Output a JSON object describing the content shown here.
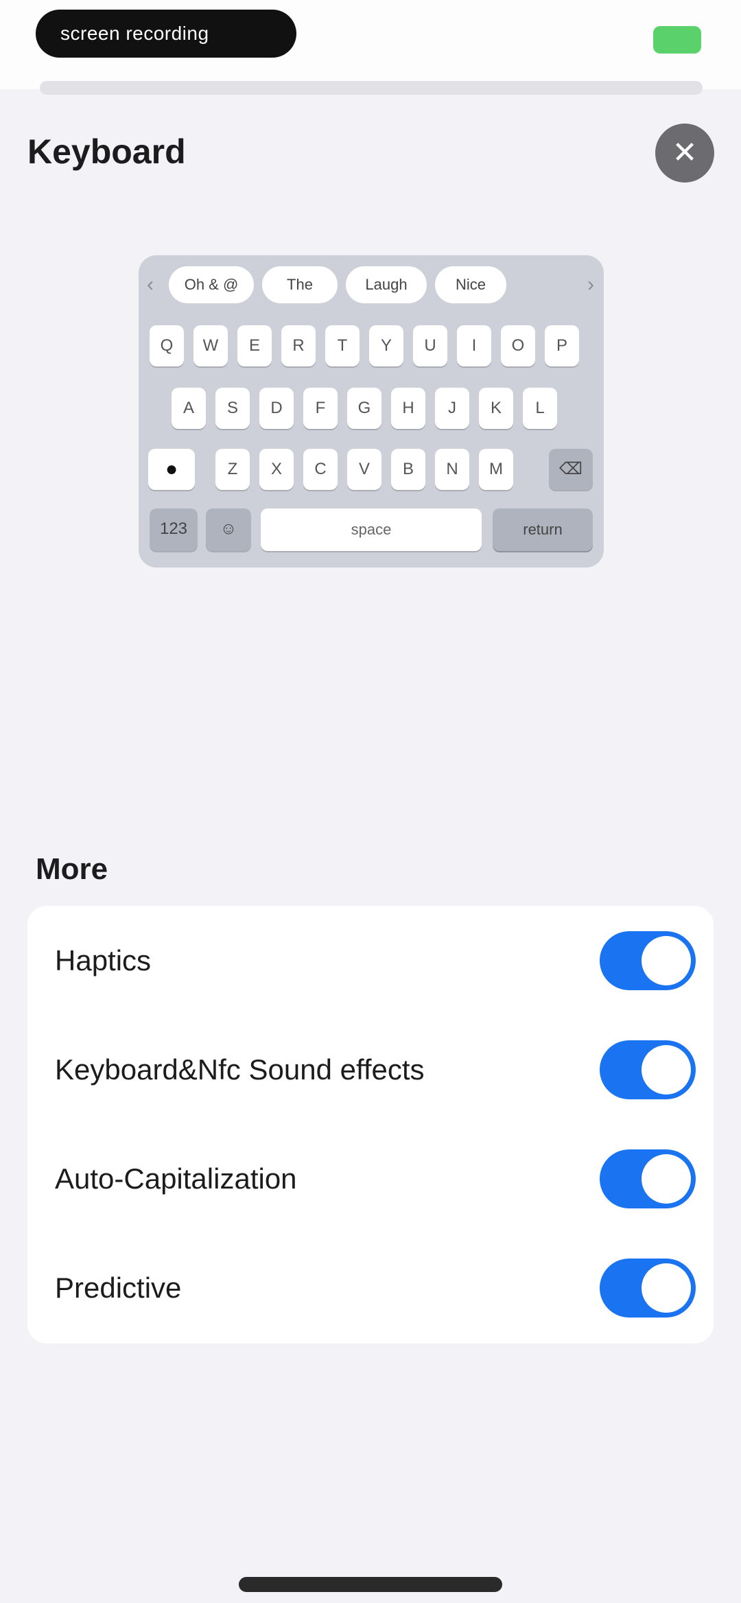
{
  "status_bar": {
    "pill_text": "screen recording"
  },
  "header": {
    "title": "Keyboard",
    "close_icon_glyph": "✕"
  },
  "keyboard_preview": {
    "suggestions": [
      "Oh  &  @",
      "The",
      "Laugh",
      "Nice"
    ],
    "row1": [
      "Q",
      "W",
      "E",
      "R",
      "T",
      "Y",
      "U",
      "I",
      "O",
      "P"
    ],
    "row2": [
      "A",
      "S",
      "D",
      "F",
      "G",
      "H",
      "J",
      "K",
      "L"
    ],
    "row3": [
      "Z",
      "X",
      "C",
      "V",
      "B",
      "N",
      "M"
    ],
    "shift_glyph": "●",
    "delete_glyph": "⌫",
    "numbers_key": "123",
    "emoji_glyph": "☺",
    "space_label": "space",
    "return_label": "return"
  },
  "more_section": {
    "title": "More",
    "items": [
      {
        "label": "Haptics",
        "on": true
      },
      {
        "label": "Keyboard&Nfc Sound effects",
        "on": true
      },
      {
        "label": "Auto-Capitalization",
        "on": true
      },
      {
        "label": "Predictive",
        "on": true
      }
    ]
  },
  "colors": {
    "toggle_on": "#1a73f0",
    "background": "#f2f2f7",
    "battery": "#5bd16b"
  }
}
